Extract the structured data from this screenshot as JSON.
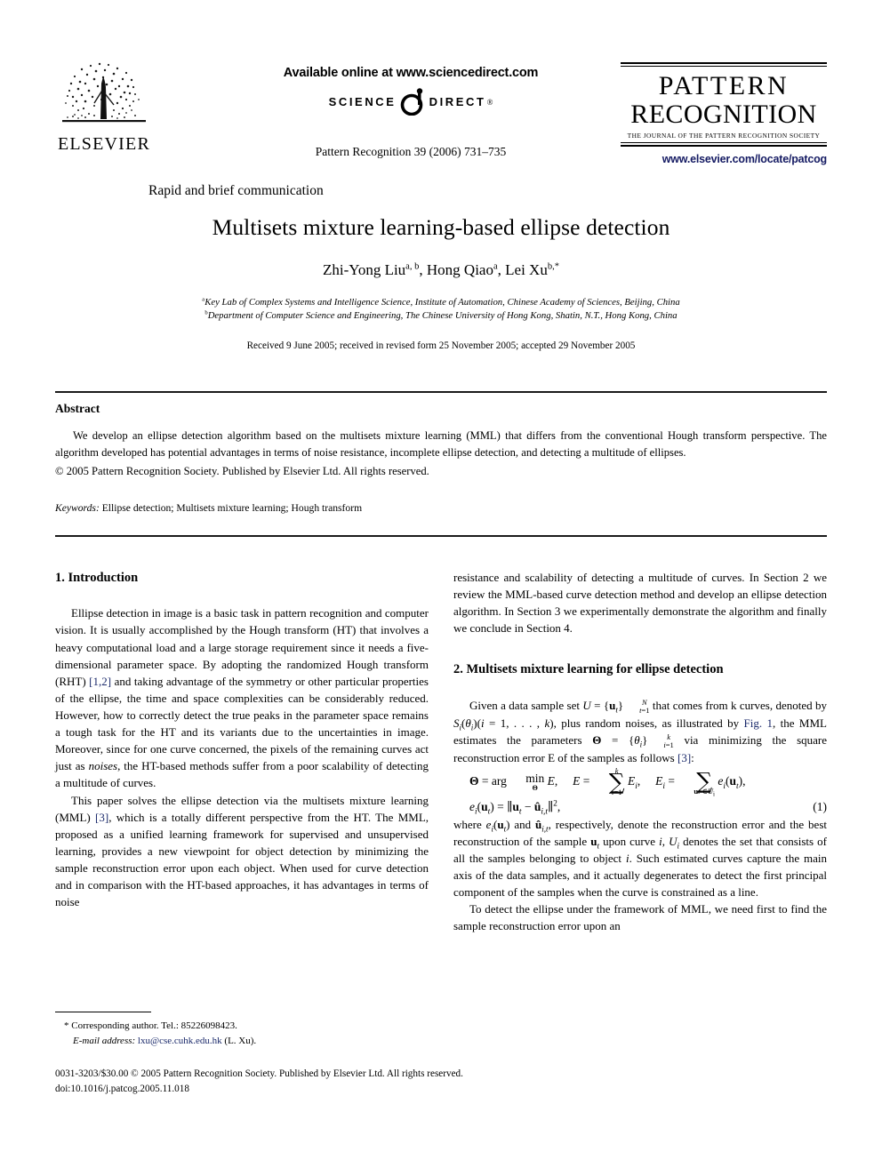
{
  "masthead": {
    "publisher_name": "ELSEVIER",
    "available_online": "Available online at www.sciencedirect.com",
    "sciencedirect_left": "SCIENCE",
    "sciencedirect_right": "DIRECT",
    "sciencedirect_mark": "®",
    "journal_reference": "Pattern Recognition 39 (2006) 731–735",
    "journal_title_line1": "PATTERN",
    "journal_title_line2": "RECOGNITION",
    "journal_tagline": "THE JOURNAL OF THE PATTERN RECOGNITION SOCIETY",
    "journal_url": "www.elsevier.com/locate/patcog",
    "url_color": "#151b63"
  },
  "article": {
    "kicker": "Rapid and brief communication",
    "title": "Multisets mixture learning-based ellipse detection",
    "authors_plain": "Zhi-Yong Liu, Hong Qiao, Lei Xu",
    "author1_name": "Zhi-Yong Liu",
    "author1_marks": "a, b",
    "author2_name": "Hong Qiao",
    "author2_marks": "a",
    "author3_name": "Lei Xu",
    "author3_marks": "b,*",
    "affiliation_a_mark": "a",
    "affiliation_a": "Key Lab of Complex Systems and Intelligence Science, Institute of Automation, Chinese Academy of Sciences, Beijing, China",
    "affiliation_b_mark": "b",
    "affiliation_b": "Department of Computer Science and Engineering, The Chinese University of Hong Kong, Shatin, N.T., Hong Kong, China",
    "received": "Received 9 June 2005; received in revised form 25 November 2005; accepted 29 November 2005"
  },
  "abstract": {
    "heading": "Abstract",
    "body": "We develop an ellipse detection algorithm based on the multisets mixture learning (MML) that differs from the conventional Hough transform perspective. The algorithm developed has potential advantages in terms of noise resistance, incomplete ellipse detection, and detecting a multitude of ellipses.",
    "copyright": "© 2005 Pattern Recognition Society. Published by Elsevier Ltd. All rights reserved."
  },
  "keywords": {
    "label": "Keywords:",
    "list": "Ellipse detection; Multisets mixture learning; Hough transform"
  },
  "sections": {
    "intro_heading": "1. Introduction",
    "intro_p1_a": "Ellipse detection in image is a basic task in pattern recognition and computer vision. It is usually accomplished by the Hough transform (HT) that involves a heavy computational load and a large storage requirement since it needs a five-dimensional parameter space. By adopting the randomized Hough transform (RHT) ",
    "intro_p1_cite": "[1,2]",
    "intro_p1_b": " and taking advantage of the symmetry or other particular properties of the ellipse, the time and space complexities can be considerably reduced. However, how to correctly detect the true peaks in the parameter space remains a tough task for the HT and its variants due to the uncertainties in image. Moreover, since for one curve concerned, the pixels of the remaining curves act just as ",
    "intro_p1_italic": "noises",
    "intro_p1_c": ", the HT-based methods suffer from a poor scalability of detecting a multitude of curves.",
    "intro_p2_a": "This paper solves the ellipse detection via the multisets mixture learning (MML) ",
    "intro_p2_cite": "[3]",
    "intro_p2_b": ", which is a totally different perspective from the HT. The MML, proposed as a unified learning framework for supervised and unsupervised learning, provides a new viewpoint for object detection by minimizing the sample reconstruction error upon each object. When used for curve detection and in comparison with the HT-based approaches, it has advantages in terms of noise",
    "intro_p2_cont": "resistance and scalability of detecting a multitude of curves. In Section 2 we review the MML-based curve detection method and develop an ellipse detection algorithm. In Section 3 we experimentally demonstrate the algorithm and finally we conclude in Section 4.",
    "sec2_heading": "2. Multisets mixture learning for ellipse detection",
    "sec2_p1_a": "Given a data sample set ",
    "sec2_p1_b": " that comes from k curves, denoted by ",
    "sec2_p1_c": ", plus random noises, as illustrated by ",
    "sec2_p1_figref": "Fig. 1",
    "sec2_p1_d": ", the MML estimates the parameters ",
    "sec2_p1_e": " via minimizing the square reconstruction error E of the samples as follows ",
    "sec2_p1_cite": "[3]",
    "sec2_p1_f": ":",
    "eq1_number": "(1)",
    "sec2_p2_a": "where ",
    "sec2_p2_b": ", respectively, denote the reconstruction error and the best reconstruction of the sample ",
    "sec2_p2_c": " upon curve ",
    "sec2_p2_d": " denotes the set that consists of all the samples belonging to object ",
    "sec2_p2_e": ". Such estimated curves capture the main axis of the data samples, and it actually degenerates to detect the first principal component of the samples when the curve is constrained as a line.",
    "sec2_p3": "To detect the ellipse under the framework of MML, we need first to find the sample reconstruction error upon an"
  },
  "footnote": {
    "corresponding": "* Corresponding author. Tel.: 85226098423.",
    "email_label": "E-mail address:",
    "email": "lxu@cse.cuhk.edu.hk",
    "email_suffix": "(L. Xu).",
    "email_color": "#1b2a6b"
  },
  "page_footer": {
    "issn_line": "0031-3203/$30.00 © 2005 Pattern Recognition Society. Published by Elsevier Ltd. All rights reserved.",
    "doi_line": "doi:10.1016/j.patcog.2005.11.018"
  }
}
